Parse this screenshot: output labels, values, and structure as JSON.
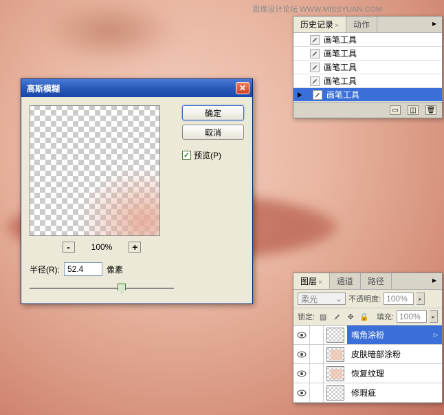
{
  "watermark": "思缘设计论坛 WWW.MISSYUAN.COM",
  "dialog": {
    "title": "高斯模糊",
    "ok": "确定",
    "cancel": "取消",
    "preview": "预览(P)",
    "zoom": "100%",
    "radius_label": "半径(R):",
    "radius_value": "52.4",
    "unit": "像素"
  },
  "history": {
    "tabs": [
      "历史记录",
      "动作"
    ],
    "active_tab": 0,
    "items": [
      "画笔工具",
      "画笔工具",
      "画笔工具",
      "画笔工具",
      "画笔工具"
    ],
    "selected": 4
  },
  "layers": {
    "tabs": [
      "图层",
      "通道",
      "路径"
    ],
    "active_tab": 0,
    "blend_mode": "柔光",
    "opacity_label": "不透明度:",
    "opacity": "100%",
    "lock_label": "锁定:",
    "fill_label": "填充:",
    "fill": "100%",
    "rows": [
      {
        "name": "嘴角涂粉",
        "skin": false
      },
      {
        "name": "皮肤暗部涂粉",
        "skin": true
      },
      {
        "name": "恢复纹理",
        "skin": true
      },
      {
        "name": "修瑕疵",
        "skin": false
      }
    ],
    "selected": 0
  }
}
